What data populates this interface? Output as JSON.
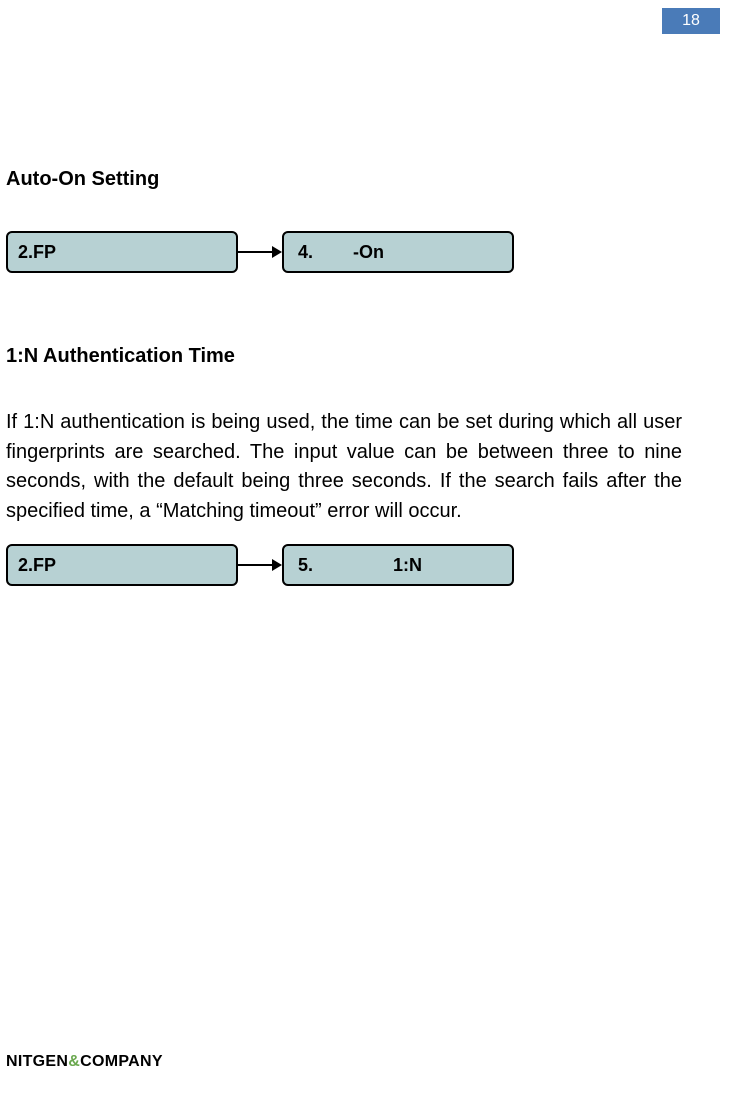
{
  "page_number": "18",
  "section1": {
    "heading": "Auto-On Setting",
    "box_left": "2.FP",
    "box_right_num": "4.",
    "box_right_text": "-On"
  },
  "section2": {
    "heading": "1:N Authentication Time",
    "paragraph": "If 1:N authentication is being used, the time can be set during which all user fingerprints are searched. The input value can be between three to nine seconds, with the default being three seconds. If the search fails after the specified time, a “Matching timeout” error will occur.",
    "box_left": "2.FP",
    "box_right_num": "5.",
    "box_right_text": "1:N"
  },
  "footer": {
    "brand_left": "NITGEN",
    "brand_amp": "&",
    "brand_right": "COMPANY"
  }
}
